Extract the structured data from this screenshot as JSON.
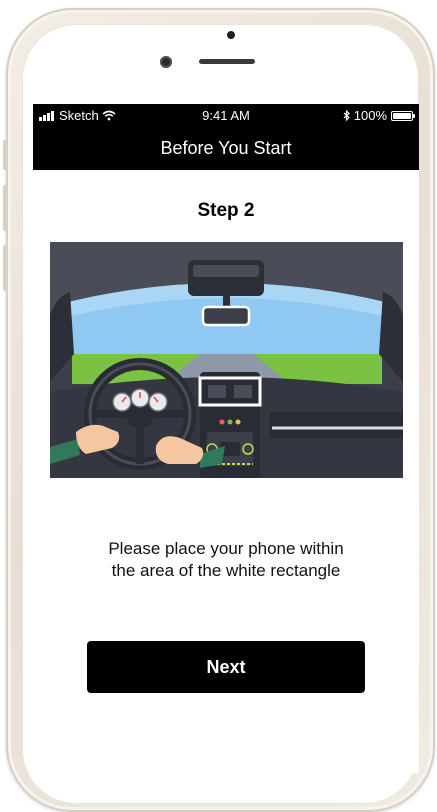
{
  "status_bar": {
    "carrier": "Sketch",
    "time": "9:41 AM",
    "battery": "100%",
    "icons": [
      "signal-icon",
      "wifi-icon",
      "bluetooth-icon",
      "battery-icon"
    ]
  },
  "nav": {
    "title": "Before You Start"
  },
  "content": {
    "step_title": "Step 2",
    "illustration_icon": "car-interior-illustration",
    "instruction_line1": "Please place your phone within",
    "instruction_line2": "the area of the white rectangle"
  },
  "actions": {
    "next_label": "Next"
  },
  "colors": {
    "nav_background": "#000000",
    "button_background": "#000000",
    "button_text": "#ffffff",
    "sky": "#8fc8f0",
    "grass": "#7bc142",
    "dashboard": "#3c3f4a"
  }
}
